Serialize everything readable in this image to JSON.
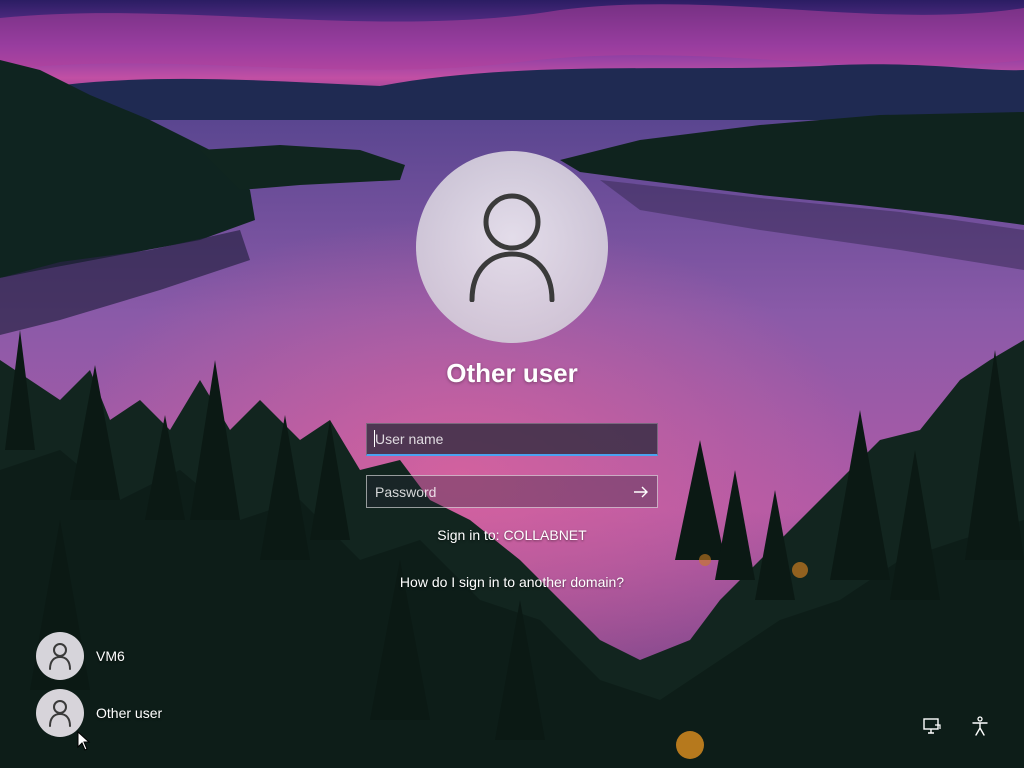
{
  "login": {
    "title": "Other user",
    "username_placeholder": "User name",
    "username_value": "",
    "password_placeholder": "Password",
    "password_value": "",
    "sign_in_to": "Sign in to: COLLABNET",
    "help_link": "How do I sign in to another domain?"
  },
  "users": [
    {
      "name": "VM6",
      "icon": "user-icon"
    },
    {
      "name": "Other user",
      "icon": "user-icon"
    }
  ],
  "corner_icons": {
    "network": "network-icon",
    "accessibility": "accessibility-icon"
  },
  "colors": {
    "focus_accent": "#4aa3f0",
    "sky_top": "#3a1f6e",
    "sky_pink": "#c2459e",
    "lake": "#b25ab0",
    "forest": "#142a26"
  }
}
